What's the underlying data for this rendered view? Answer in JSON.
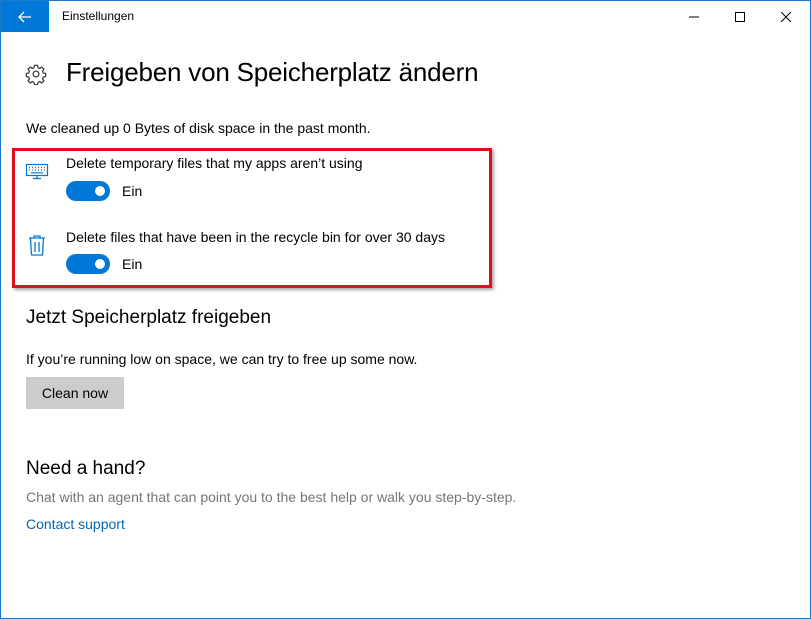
{
  "window": {
    "title": "Einstellungen",
    "accent": "#0078d7"
  },
  "header": {
    "title": "Freigeben von Speicherplatz ändern",
    "icon": "gear-icon"
  },
  "summary": "We cleaned up 0 Bytes of disk space in the past month.",
  "options": [
    {
      "icon": "keyboard-icon",
      "label": "Delete temporary files that my apps aren’t using",
      "toggle_on": true,
      "toggle_state": "Ein"
    },
    {
      "icon": "trash-icon",
      "label": "Delete files that have been in the recycle bin for over 30 days",
      "toggle_on": true,
      "toggle_state": "Ein"
    }
  ],
  "free_now": {
    "title": "Jetzt Speicherplatz freigeben",
    "description": "If you’re running low on space, we can try to free up some now.",
    "button": "Clean now"
  },
  "help": {
    "title": "Need a hand?",
    "description": "Chat with an agent that can point you to the best help or walk you step-by-step.",
    "link": "Contact support",
    "link_color": "#0067b8",
    "muted_color": "#767676"
  },
  "highlight_color": "#e10e1e"
}
